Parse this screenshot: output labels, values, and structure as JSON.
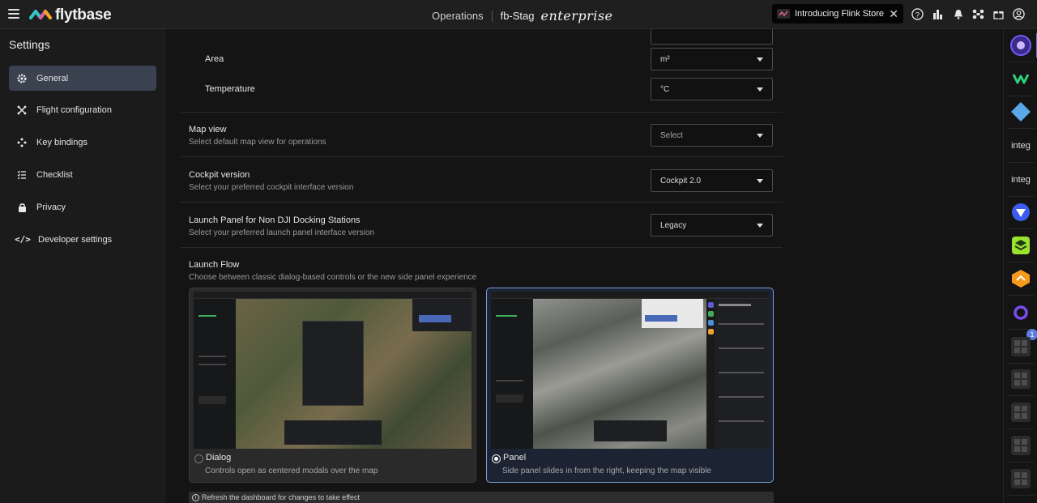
{
  "topbar": {
    "logo_text": "flytbase",
    "operations": "Operations",
    "environment": "fb-Stag",
    "edition": "enterprise",
    "announcement": "Introducing Flink Store"
  },
  "sidebar": {
    "title": "Settings",
    "items": [
      {
        "label": "General",
        "icon": "gear-icon"
      },
      {
        "label": "Flight configuration",
        "icon": "drone-icon"
      },
      {
        "label": "Key bindings",
        "icon": "gamepad-icon"
      },
      {
        "label": "Checklist",
        "icon": "checklist-icon"
      },
      {
        "label": "Privacy",
        "icon": "lock-icon"
      },
      {
        "label": "Developer settings",
        "icon": "code-icon"
      }
    ]
  },
  "settings": {
    "area": {
      "label": "Area",
      "value": "m²"
    },
    "temperature": {
      "label": "Temperature",
      "value": "°C"
    },
    "map_view": {
      "label": "Map view",
      "description": "Select default map view for operations",
      "value": "Select"
    },
    "cockpit": {
      "label": "Cockpit version",
      "description": "Select your preferred cockpit interface version",
      "value": "Cockpit 2.0"
    },
    "launch_panel": {
      "label": "Launch Panel for Non DJI Docking Stations",
      "description": "Select your preferred launch panel interface version",
      "value": "Legacy"
    },
    "launch_flow": {
      "label": "Launch Flow",
      "description": "Choose between classic dialog-based controls or the new side panel experience",
      "options": [
        {
          "title": "Dialog",
          "description": "Controls open as centered modals over the map",
          "selected": false
        },
        {
          "title": "Panel",
          "description": "Side panel slides in from the right, keeping the map visible",
          "selected": true
        }
      ]
    },
    "notice": "Refresh the dashboard for changes to take effect"
  },
  "rightrail": {
    "broken_label": "integ",
    "badge_count": "1"
  },
  "colors": {
    "active_nav": "#3a4250",
    "panel_border": "#7b9bd8"
  }
}
